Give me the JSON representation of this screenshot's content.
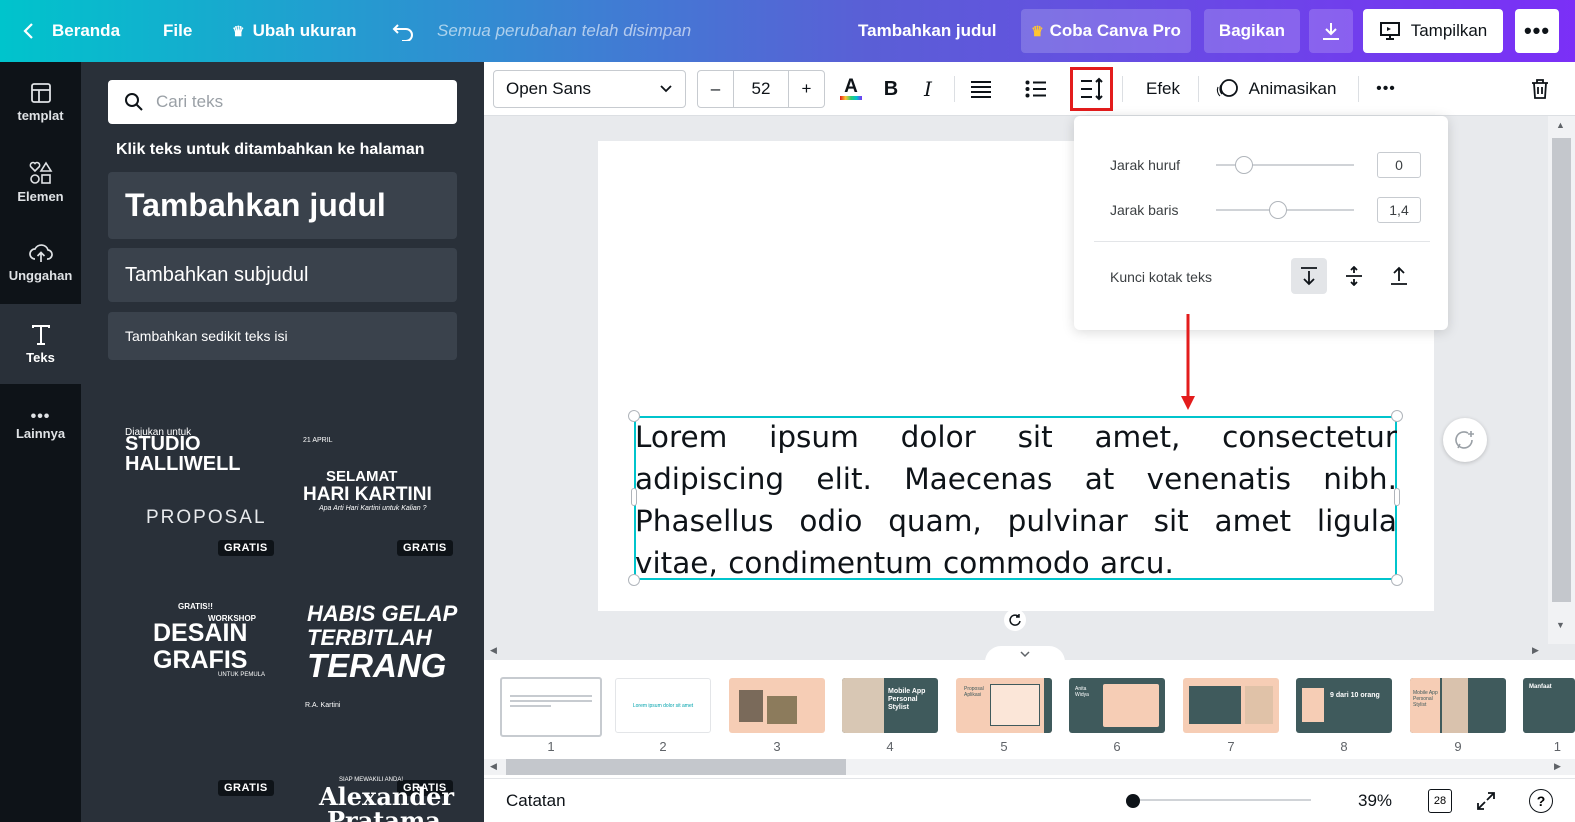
{
  "topbar": {
    "home": "Beranda",
    "file": "File",
    "resize": "Ubah ukuran",
    "saved_status": "Semua perubahan telah disimpan",
    "title": "Tambahkan judul",
    "pro_button": "Coba Canva Pro",
    "share_button": "Bagikan",
    "present_button": "Tampilkan"
  },
  "rail": {
    "items": [
      {
        "label": "templat",
        "icon": "template-icon"
      },
      {
        "label": "Elemen",
        "icon": "elements-icon"
      },
      {
        "label": "Unggahan",
        "icon": "upload-icon"
      },
      {
        "label": "Teks",
        "icon": "text-icon"
      },
      {
        "label": "Lainnya",
        "icon": "more-icon"
      }
    ]
  },
  "panel": {
    "search_placeholder": "Cari teks",
    "hint": "Klik teks untuk ditambahkan ke halaman",
    "add_heading": "Tambahkan judul",
    "add_subheading": "Tambahkan subjudul",
    "add_body": "Tambahkan sedikit teks isi",
    "templates": [
      {
        "line1": "Diajukan untuk",
        "line2": "STUDIO",
        "line3": "HALLIWELL",
        "line4": "PROPOSAL",
        "badge": "GRATIS"
      },
      {
        "line1": "21 APRIL",
        "line2": "SELAMAT",
        "line3": "HARI KARTINI",
        "line4": "Apa Arti Hari Kartini untuk Kalian ?",
        "badge": "GRATIS"
      },
      {
        "line1": "GRATIS!!",
        "line2": "WORKSHOP",
        "line3": "DESAIN",
        "line4": "GRAFIS",
        "line5": "UNTUK PEMULA",
        "badge": "GRATIS"
      },
      {
        "line1": "HABIS GELAP",
        "line2": "TERBITLAH",
        "line3": "TERANG",
        "line4": "R.A. Kartini",
        "badge": "GRATIS"
      },
      {
        "line1": "SIAP MEWAKILI ANDA!",
        "line2": "Alexander",
        "line3": "Pratama"
      }
    ]
  },
  "toolbar": {
    "font": "Open Sans",
    "font_size": "52",
    "minus": "–",
    "plus": "+",
    "bold": "B",
    "italic": "I",
    "effects": "Efek",
    "animate": "Animasikan"
  },
  "spacing_popover": {
    "letter_spacing_label": "Jarak huruf",
    "letter_spacing_value": "0",
    "letter_spacing_level": 0.2,
    "line_spacing_label": "Jarak baris",
    "line_spacing_value": "1,4",
    "line_spacing_level": 0.45,
    "lock_label": "Kunci kotak teks"
  },
  "canvas": {
    "body_text": "Lorem ipsum dolor sit amet, consectetur adipiscing elit. Maecenas at venenatis nibh. Phasellus odio quam, pulvinar sit amet ligula vitae, condimentum commodo arcu."
  },
  "pages": {
    "numbers": [
      "1",
      "2",
      "3",
      "4",
      "5",
      "6",
      "7",
      "8",
      "9",
      "1"
    ],
    "thumb_texts": [
      "",
      "Lorem ipsum dolor sit amet",
      "",
      "Mobile App Personal Stylist",
      "Proposal Aplikasi",
      "Anita Widya",
      "",
      "9 dari 10 orang",
      "Mobile App Personal Stylist",
      "Manfaat"
    ]
  },
  "status": {
    "notes": "Catatan",
    "zoom": "39%",
    "page_count": "28",
    "help": "?"
  },
  "colors": {
    "accent": "#00c4cc",
    "panel": "#293039",
    "rail": "#0e1318",
    "highlight": "#e31c1c"
  }
}
